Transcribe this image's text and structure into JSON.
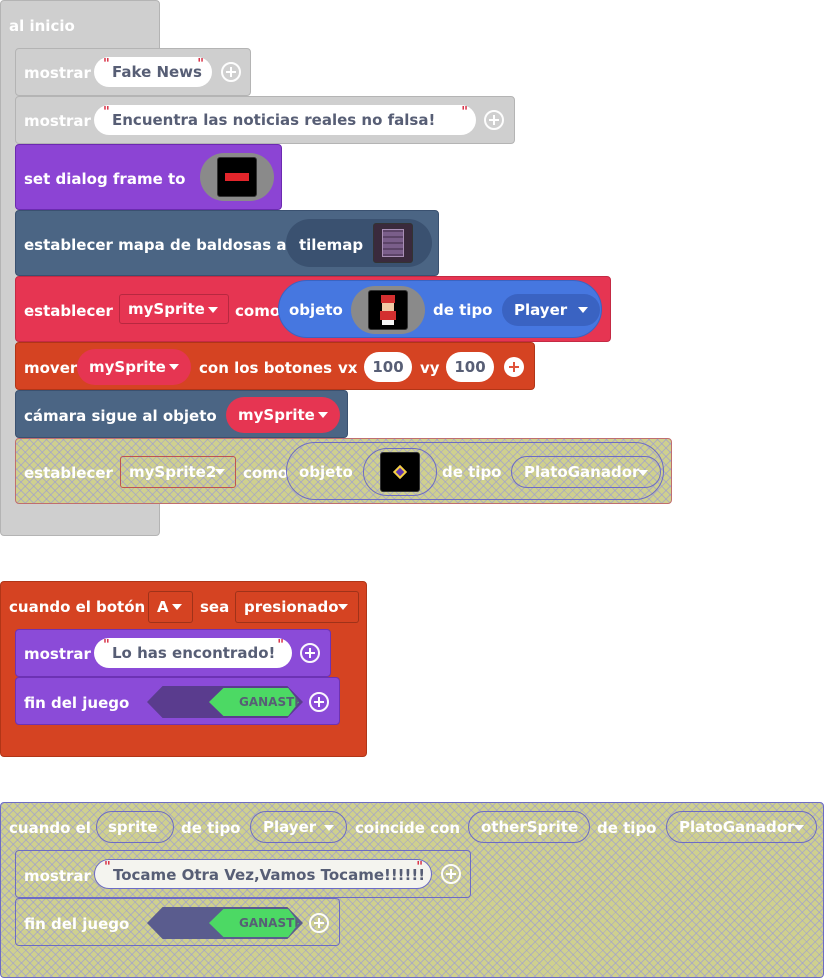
{
  "on_start": {
    "hat_label": "al inicio",
    "show1_label": "mostrar",
    "show1_text": "Fake News",
    "show2_label": "mostrar",
    "show2_text": "Encuentra las noticias reales no falsa!",
    "dialog_label": "set dialog frame to",
    "tilemap_label": "establecer mapa de baldosas a",
    "tilemap_value": "tilemap",
    "set_sprite": {
      "label": "establecer",
      "var": "mySprite",
      "como": "como",
      "objeto": "objeto",
      "de_tipo": "de tipo",
      "kind": "Player"
    },
    "move": {
      "label": "mover",
      "var": "mySprite",
      "con": "con los botones",
      "vx_label": "vx",
      "vx": "100",
      "vy_label": "vy",
      "vy": "100"
    },
    "camera": {
      "label": "cámara sigue al objeto",
      "var": "mySprite"
    },
    "set_sprite2": {
      "label": "establecer",
      "var": "mySprite2",
      "como": "como",
      "objeto": "objeto",
      "de_tipo": "de tipo",
      "kind": "PlatoGanador"
    }
  },
  "on_button": {
    "hat_pre": "cuando el",
    "boton": "botón",
    "button": "A",
    "sea": "sea",
    "event": "presionado",
    "show_label": "mostrar",
    "show_text": "Lo has encontrado!",
    "game_over_label": "fin del juego",
    "game_over_value": "GANASTE"
  },
  "on_overlap": {
    "hat_pre": "cuando el",
    "sprite": "sprite",
    "de_tipo1": "de tipo",
    "kind1": "Player",
    "coincide": "coincide con",
    "other": "otherSprite",
    "de_tipo2": "de tipo",
    "kind2": "PlatoGanador",
    "show_label": "mostrar",
    "show_text": "Tocame Otra Vez,Vamos Tocame!!!!!!",
    "game_over_label": "fin del juego",
    "game_over_value": "GANASTE"
  },
  "colors": {
    "events_gray": "#cfcfcf",
    "dialog_purple": "#8c44d4",
    "scene_slate": "#4b6584",
    "sprites_red": "#e63552",
    "controller_orange": "#d54322",
    "game_purple": "#8b4bd8",
    "disabled_olive": "#cfd08e"
  }
}
